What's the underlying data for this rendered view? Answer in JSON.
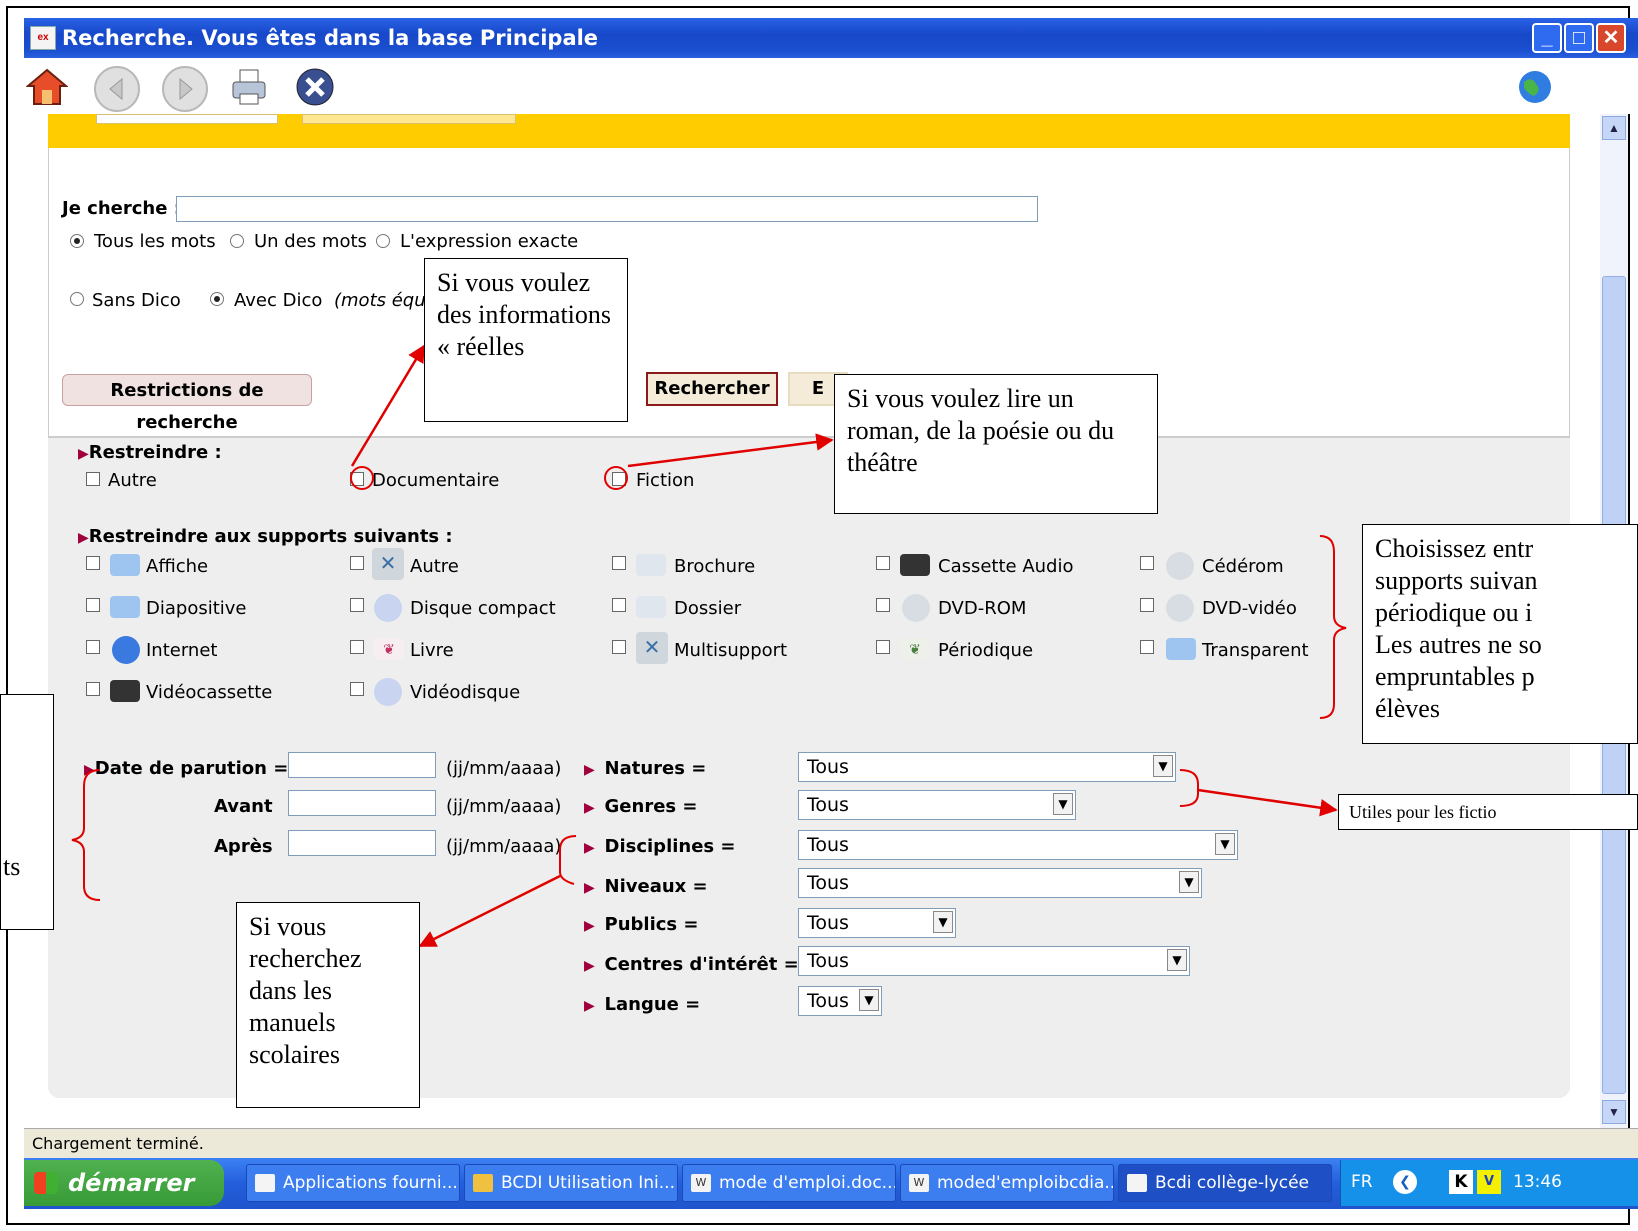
{
  "window": {
    "title": "Recherche. Vous êtes dans la base Principale",
    "app_icon": "ex",
    "minimize": "_",
    "maximize": "□",
    "close": "✕"
  },
  "toolbar": {
    "icons": [
      "home-icon",
      "back-icon",
      "forward-icon",
      "print-icon",
      "stop-icon",
      "globe-icon"
    ]
  },
  "search": {
    "label": "Je cherche :",
    "value": "",
    "mode_options": [
      "Tous les mots",
      "Un des mots",
      "L'expression exacte"
    ],
    "dico_options": [
      "Sans Dico",
      "Avec Dico"
    ],
    "dico_note": "(mots équ"
  },
  "buttons": {
    "restrictions": "Restrictions de recherche",
    "search": "Rechercher",
    "other": "E"
  },
  "restrict": {
    "label": "Restreindre :",
    "options": [
      "Autre",
      "Documentaire",
      "Fiction"
    ]
  },
  "supports": {
    "label": "Restreindre aux supports suivants :",
    "items": [
      "Affiche",
      "Autre",
      "Brochure",
      "Cassette Audio",
      "Cédérom",
      "Diapositive",
      "Disque compact",
      "Dossier",
      "DVD-ROM",
      "DVD-vidéo",
      "Internet",
      "Livre",
      "Multisupport",
      "Périodique",
      "Transparent",
      "Vidéocassette",
      "Vidéodisque"
    ]
  },
  "dates": {
    "label": "Date de parution =",
    "before": "Avant",
    "after": "Après",
    "format": "(jj/mm/aaaa)"
  },
  "filters": [
    {
      "label": "Natures =",
      "value": "Tous"
    },
    {
      "label": "Genres =",
      "value": "Tous"
    },
    {
      "label": "Disciplines =",
      "value": "Tous"
    },
    {
      "label": "Niveaux =",
      "value": "Tous"
    },
    {
      "label": "Publics =",
      "value": "Tous"
    },
    {
      "label": "Centres d'intérêt =",
      "value": "Tous"
    },
    {
      "label": "Langue =",
      "value": "Tous"
    }
  ],
  "callouts": {
    "documentaire": "Si vous voulez des informations « réelles",
    "fiction": "Si vous voulez lire un roman, de la poésie ou du théâtre",
    "supports": "Choisissez entr supports suivan périodique ou i Les autres ne so empruntables p élèves",
    "natures": "Utiles pour les fictio",
    "manuels": "Si vous recherchez dans les manuels scolaires",
    "dates": "ts"
  },
  "status": {
    "text": "Chargement terminé."
  },
  "taskbar": {
    "start": "démarrer",
    "tasks": [
      "Applications fourni...",
      "BCDI Utilisation Ini...",
      "mode d'emploi.doc...",
      "moded'emploibcdia...",
      "Bcdi collège-lycée"
    ],
    "lang": "FR",
    "clock": "13:46"
  },
  "colors": {
    "accent_orange": "#ffcc00",
    "title_blue": "#1748c9",
    "arrow_red": "#e00000",
    "button_border": "#8b1a1a"
  }
}
